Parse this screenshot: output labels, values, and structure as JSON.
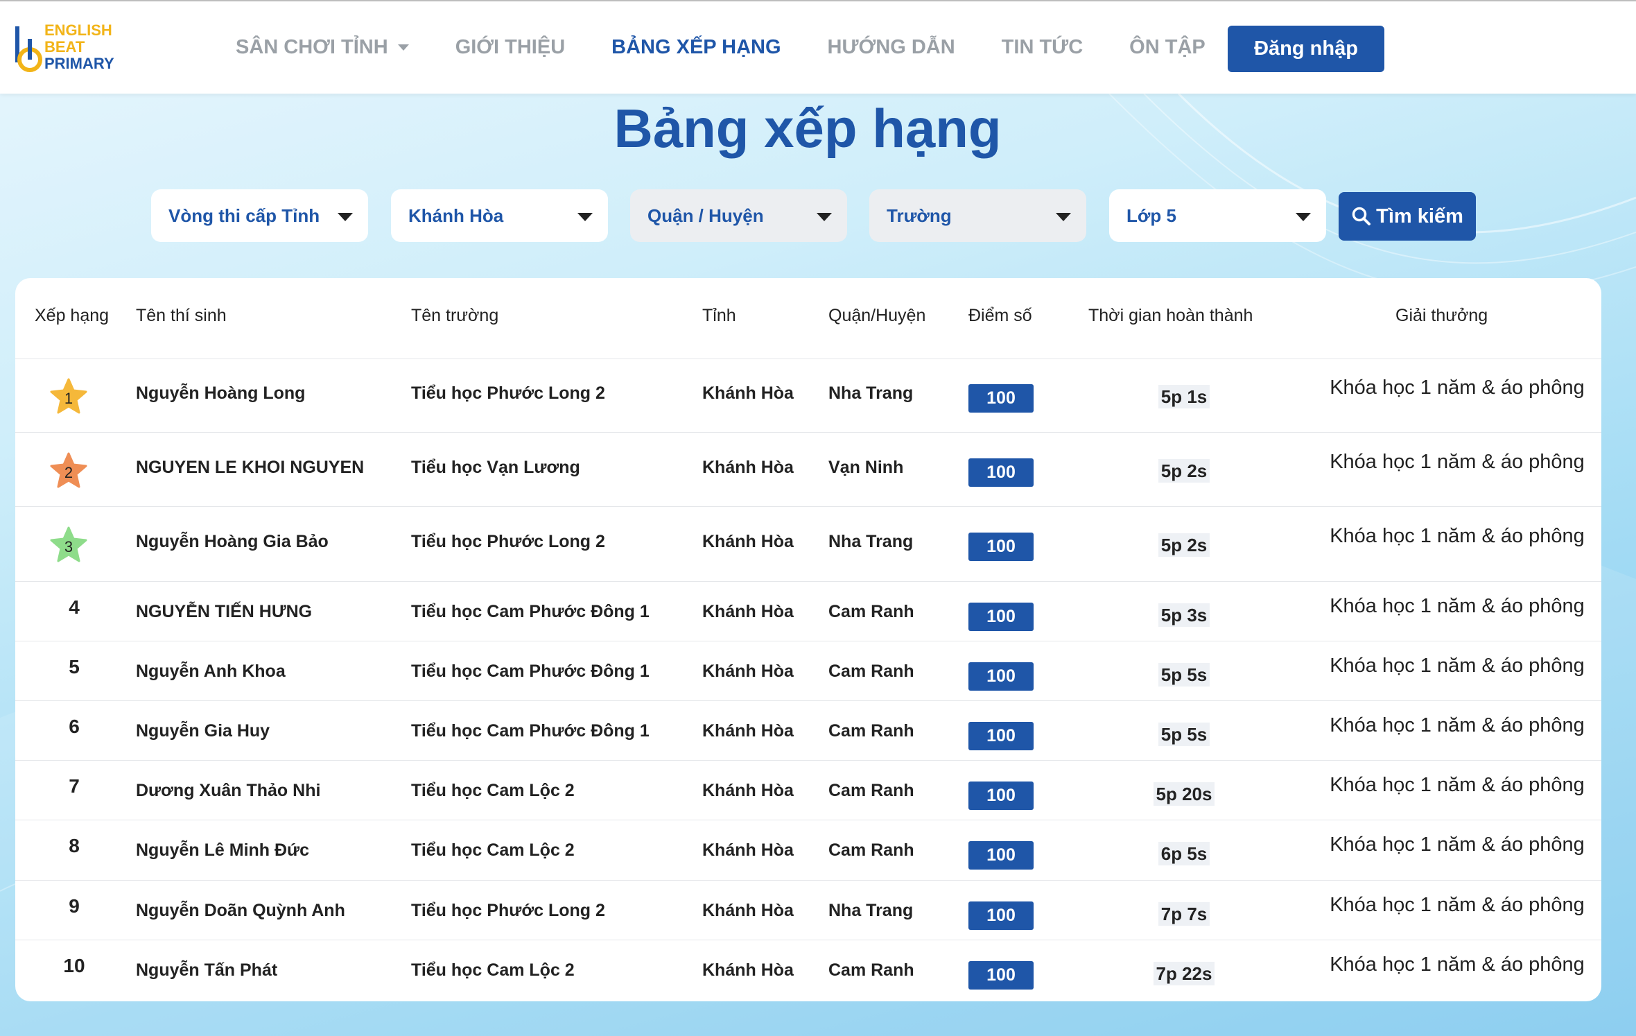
{
  "logo": {
    "line1": "ENGLISH",
    "line2": "BEAT",
    "line3": "PRIMARY"
  },
  "nav": {
    "items": [
      "SÂN CHƠI TỈNH",
      "GIỚI THIỆU",
      "BẢNG XẾP HẠNG",
      "HƯỚNG DẪN",
      "TIN TỨC",
      "ÔN TẬP"
    ],
    "active": "BẢNG XẾP HẠNG",
    "login_label": "Đăng nhập"
  },
  "page_title": "Bảng xếp hạng",
  "filters": {
    "round": "Vòng thi cấp Tỉnh",
    "province": "Khánh Hòa",
    "district": "Quận / Huyện",
    "school": "Trường",
    "grade": "Lớp 5",
    "search_label": "Tìm kiếm"
  },
  "table": {
    "headers": [
      "Xếp hạng",
      "Tên thí sinh",
      "Tên trường",
      "Tỉnh",
      "Quận/Huyện",
      "Điểm số",
      "Thời gian hoàn thành",
      "Giải thưởng"
    ],
    "rows": [
      {
        "rank": "1",
        "name": "Nguyễn Hoàng Long",
        "school": "Tiểu học Phước Long 2",
        "province": "Khánh Hòa",
        "district": "Nha Trang",
        "score": "100",
        "time": "5p 1s",
        "prize": "Khóa học 1 năm & áo phông"
      },
      {
        "rank": "2",
        "name": "NGUYEN LE KHOI NGUYEN",
        "school": "Tiểu học Vạn Lương",
        "province": "Khánh Hòa",
        "district": "Vạn Ninh",
        "score": "100",
        "time": "5p 2s",
        "prize": "Khóa học 1 năm & áo phông"
      },
      {
        "rank": "3",
        "name": "Nguyễn Hoàng Gia Bảo",
        "school": "Tiểu học Phước Long 2",
        "province": "Khánh Hòa",
        "district": "Nha Trang",
        "score": "100",
        "time": "5p 2s",
        "prize": "Khóa học 1 năm & áo phông"
      },
      {
        "rank": "4",
        "name": "NGUYỄN TIẾN HƯNG",
        "school": "Tiểu học Cam Phước Đông 1",
        "province": "Khánh Hòa",
        "district": "Cam Ranh",
        "score": "100",
        "time": "5p 3s",
        "prize": "Khóa học 1 năm & áo phông"
      },
      {
        "rank": "5",
        "name": "Nguyễn Anh Khoa",
        "school": "Tiểu học Cam Phước Đông 1",
        "province": "Khánh Hòa",
        "district": "Cam Ranh",
        "score": "100",
        "time": "5p 5s",
        "prize": "Khóa học 1 năm & áo phông"
      },
      {
        "rank": "6",
        "name": "Nguyễn Gia Huy",
        "school": "Tiểu học Cam Phước Đông 1",
        "province": "Khánh Hòa",
        "district": "Cam Ranh",
        "score": "100",
        "time": "5p 5s",
        "prize": "Khóa học 1 năm & áo phông"
      },
      {
        "rank": "7",
        "name": "Dương Xuân Thảo Nhi",
        "school": "Tiểu học Cam Lộc 2",
        "province": "Khánh Hòa",
        "district": "Cam Ranh",
        "score": "100",
        "time": "5p 20s",
        "prize": "Khóa học 1 năm & áo phông"
      },
      {
        "rank": "8",
        "name": "Nguyễn Lê Minh Đức",
        "school": "Tiểu học Cam Lộc 2",
        "province": "Khánh Hòa",
        "district": "Cam Ranh",
        "score": "100",
        "time": "6p 5s",
        "prize": "Khóa học 1 năm & áo phông"
      },
      {
        "rank": "9",
        "name": "Nguyễn Doãn Quỳnh Anh",
        "school": "Tiểu học Phước Long 2",
        "province": "Khánh Hòa",
        "district": "Nha Trang",
        "score": "100",
        "time": "7p 7s",
        "prize": "Khóa học 1 năm & áo phông"
      },
      {
        "rank": "10",
        "name": "Nguyễn Tấn Phát",
        "school": "Tiểu học Cam Lộc 2",
        "province": "Khánh Hòa",
        "district": "Cam Ranh",
        "score": "100",
        "time": "7p 22s",
        "prize": "Khóa học 1 năm & áo phông"
      }
    ]
  },
  "colors": {
    "brand_blue": "#1f56a8",
    "logo_yellow": "#f2b418",
    "star_gold": "#f5b83a",
    "star_bronze": "#ef8e55",
    "star_green": "#8edc8a"
  },
  "icons": {
    "rank_badge": "star-icon",
    "search": "search-icon",
    "dropdown": "caret-down-icon"
  }
}
